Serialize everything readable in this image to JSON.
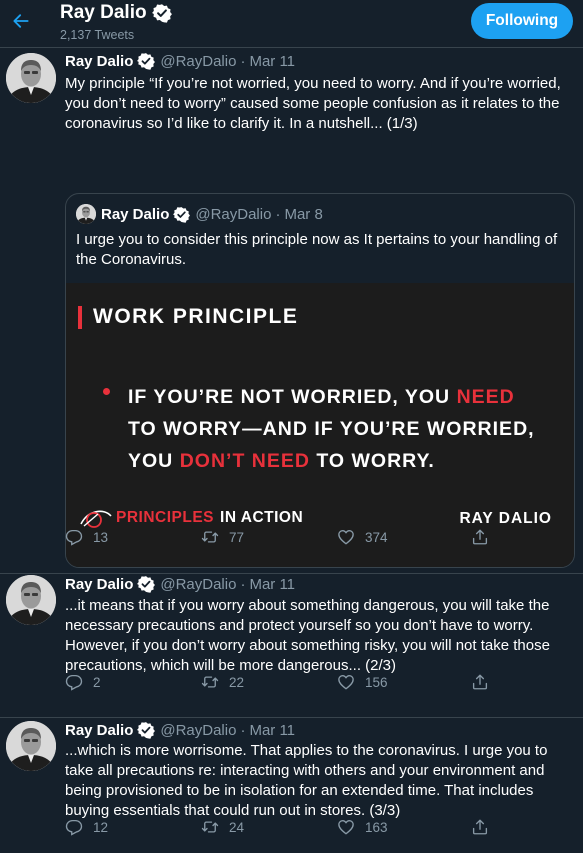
{
  "header": {
    "name": "Ray Dalio",
    "tweet_count": "2,137 Tweets",
    "follow_label": "Following"
  },
  "colors": {
    "accent": "#1da1f2",
    "background": "#15202b",
    "muted": "#8899a6",
    "card_red": "#e8313b"
  },
  "tweets": [
    {
      "name": "Ray Dalio",
      "handle": "@RayDalio",
      "dot": "·",
      "date": "Mar 11",
      "text": "My principle “If you’re not worried, you need to worry. And if you’re worried, you don’t need to worry” caused some people confusion as it relates to the coronavirus so I’d like to clarify it. In a nutshell... (1/3)",
      "quoted": {
        "name": "Ray Dalio",
        "handle": "@RayDalio",
        "dot": "·",
        "date": "Mar 8",
        "text": "I urge you to consider this principle now as It pertains to your handling of the Coronavirus.",
        "card": {
          "title": "WORK PRINCIPLE",
          "l1a": "IF YOU’RE NOT WORRIED, YOU ",
          "l1b": "NEED",
          "l2": "TO WORRY—AND IF YOU’RE WORRIED,",
          "l3a": "YOU ",
          "l3b": "DON’T NEED",
          "l3c": " TO WORRY.",
          "brand_a": "PRINCIPLES",
          "brand_b": "IN ACTION",
          "signature": "RAY DALIO"
        }
      },
      "replies": "13",
      "retweets": "77",
      "likes": "374"
    },
    {
      "name": "Ray Dalio",
      "handle": "@RayDalio",
      "dot": "·",
      "date": "Mar 11",
      "text": "...it means that if you worry about something dangerous, you will take the necessary precautions and protect yourself so you don’t have to worry. However, if you don’t worry about something risky, you will not take those precautions, which will be more dangerous... (2/3)",
      "replies": "2",
      "retweets": "22",
      "likes": "156"
    },
    {
      "name": "Ray Dalio",
      "handle": "@RayDalio",
      "dot": "·",
      "date": "Mar 11",
      "text": "...which is more worrisome. That applies to the coronavirus. I urge you to take all precautions re: interacting with others and your environment and being provisioned to be in isolation for an extended time. That includes buying essentials that could run out in stores. (3/3)",
      "replies": "12",
      "retweets": "24",
      "likes": "163"
    }
  ]
}
